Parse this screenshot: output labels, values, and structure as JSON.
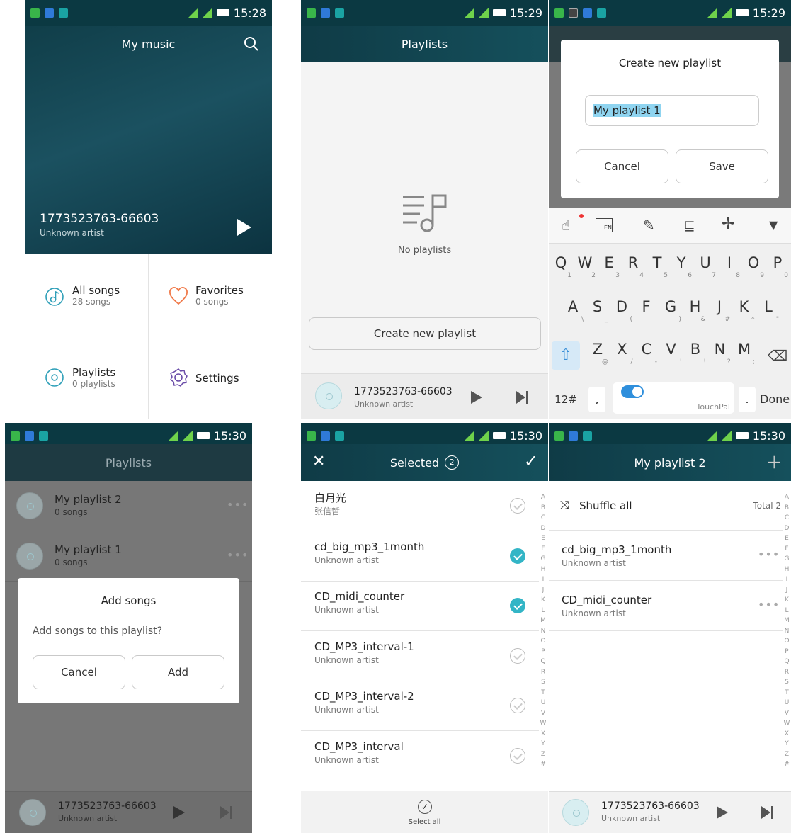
{
  "status": {
    "p1": "15:28",
    "p2": "15:29",
    "p3": "15:29",
    "p4": "15:30",
    "p5": "15:30",
    "p6": "15:30"
  },
  "mymusic": {
    "title": "My music",
    "track": "1773523763-66603",
    "artist": "Unknown artist",
    "all_songs": "All songs",
    "all_songs_count": "28 songs",
    "favorites": "Favorites",
    "favorites_count": "0 songs",
    "playlists": "Playlists",
    "playlists_count": "0 playlists",
    "settings": "Settings"
  },
  "playlists_empty": {
    "title": "Playlists",
    "empty": "No playlists",
    "create": "Create new playlist",
    "track": "1773523763-66603",
    "artist": "Unknown artist"
  },
  "create_dialog": {
    "title": "Create new playlist",
    "input_value": "My playlist 1",
    "cancel": "Cancel",
    "save": "Save",
    "keys_row1": [
      [
        "Q",
        "1"
      ],
      [
        "W",
        "2"
      ],
      [
        "E",
        "3"
      ],
      [
        "R",
        "4"
      ],
      [
        "T",
        "5"
      ],
      [
        "Y",
        "6"
      ],
      [
        "U",
        "7"
      ],
      [
        "I",
        "8"
      ],
      [
        "O",
        "9"
      ],
      [
        "P",
        "0"
      ]
    ],
    "keys_row2": [
      [
        "A",
        "\\"
      ],
      [
        "S",
        "_"
      ],
      [
        "D",
        "("
      ],
      [
        "F",
        ""
      ],
      [
        "G",
        ")"
      ],
      [
        "H",
        "&"
      ],
      [
        "J",
        "#"
      ],
      [
        "K",
        "*"
      ],
      [
        "L",
        "\""
      ]
    ],
    "keys_row3": [
      [
        "Z",
        "@"
      ],
      [
        "X",
        "/"
      ],
      [
        "C",
        "-"
      ],
      [
        "V",
        "'"
      ],
      [
        "B",
        "!"
      ],
      [
        "N",
        "?"
      ],
      [
        "M",
        ";"
      ]
    ],
    "sym": "12#",
    "comma": ",",
    "space": "TouchPal",
    "period": ".",
    "done": "Done",
    "en_label": "EN"
  },
  "playlists_add": {
    "title": "Playlists",
    "items": [
      {
        "name": "My playlist 2",
        "count": "0 songs"
      },
      {
        "name": "My playlist 1",
        "count": "0 songs"
      }
    ],
    "dialog_title": "Add songs",
    "dialog_msg": "Add songs to this playlist?",
    "cancel": "Cancel",
    "add": "Add",
    "track": "1773523763-66603",
    "artist": "Unknown artist"
  },
  "select": {
    "title": "Selected",
    "count": "2",
    "songs": [
      {
        "name": "白月光",
        "artist": "张信哲",
        "checked": false
      },
      {
        "name": "cd_big_mp3_1month",
        "artist": "Unknown artist",
        "checked": true
      },
      {
        "name": "CD_midi_counter",
        "artist": "Unknown artist",
        "checked": true
      },
      {
        "name": "CD_MP3_interval-1",
        "artist": "Unknown artist",
        "checked": false
      },
      {
        "name": "CD_MP3_interval-2",
        "artist": "Unknown artist",
        "checked": false
      },
      {
        "name": "CD_MP3_interval",
        "artist": "Unknown artist",
        "checked": false
      }
    ],
    "select_all": "Select all",
    "index": [
      "A",
      "B",
      "C",
      "D",
      "E",
      "F",
      "G",
      "H",
      "I",
      "J",
      "K",
      "L",
      "M",
      "N",
      "O",
      "P",
      "Q",
      "R",
      "S",
      "T",
      "U",
      "V",
      "W",
      "X",
      "Y",
      "Z",
      "#"
    ]
  },
  "playlist2": {
    "title": "My playlist 2",
    "shuffle": "Shuffle all",
    "total": "Total 2",
    "songs": [
      {
        "name": "cd_big_mp3_1month",
        "artist": "Unknown artist"
      },
      {
        "name": "CD_midi_counter",
        "artist": "Unknown artist"
      }
    ],
    "track": "1773523763-66603",
    "artist": "Unknown artist"
  },
  "colors": {
    "accent": "#33b5c6",
    "topbar": "#0f3b46",
    "heart": "#f07a4a"
  }
}
